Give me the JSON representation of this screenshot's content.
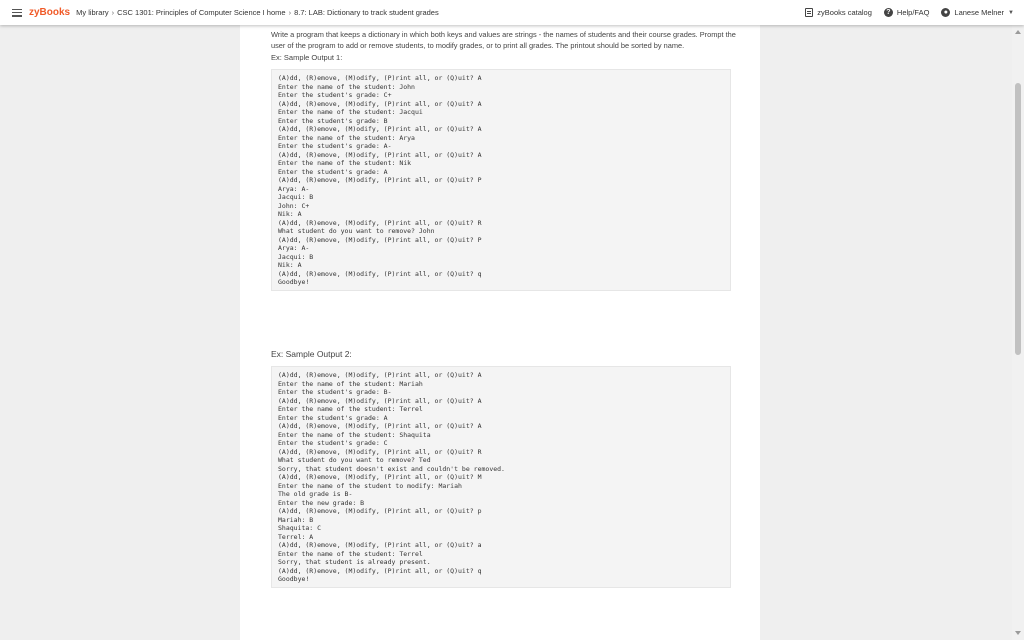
{
  "header": {
    "logo": "zyBooks",
    "breadcrumbs": [
      "My library",
      "CSC 1301: Principles of Computer Science I home",
      "8.7: LAB: Dictionary to track student grades"
    ],
    "catalog_label": "zyBooks catalog",
    "help_label": "Help/FAQ",
    "user_name": "Lanese Melner"
  },
  "content": {
    "intro": "Write a program that keeps a dictionary in which both keys and values are strings - the names of students and their course grades. Prompt the user of the program to add or remove students, to modify grades, or to print all grades. The printout should be sorted by name.",
    "sample1_label": "Ex: Sample Output 1:",
    "sample1_lines": [
      "(A)dd, (R)emove, (M)odify, (P)rint all, or (Q)uit? A",
      "Enter the name of the student: John",
      "Enter the student's grade: C+",
      "(A)dd, (R)emove, (M)odify, (P)rint all, or (Q)uit? A",
      "Enter the name of the student: Jacqui",
      "Enter the student's grade: B",
      "(A)dd, (R)emove, (M)odify, (P)rint all, or (Q)uit? A",
      "Enter the name of the student: Arya",
      "Enter the student's grade: A-",
      "(A)dd, (R)emove, (M)odify, (P)rint all, or (Q)uit? A",
      "Enter the name of the student: Nik",
      "Enter the student's grade: A",
      "(A)dd, (R)emove, (M)odify, (P)rint all, or (Q)uit? P",
      "Arya: A-",
      "Jacqui: B",
      "John: C+",
      "Nik: A",
      "(A)dd, (R)emove, (M)odify, (P)rint all, or (Q)uit? R",
      "What student do you want to remove? John",
      "(A)dd, (R)emove, (M)odify, (P)rint all, or (Q)uit? P",
      "Arya: A-",
      "Jacqui: B",
      "Nik: A",
      "(A)dd, (R)emove, (M)odify, (P)rint all, or (Q)uit? q",
      "Goodbye!"
    ],
    "sample2_label": "Ex: Sample Output 2:",
    "sample2_lines": [
      "(A)dd, (R)emove, (M)odify, (P)rint all, or (Q)uit? A",
      "Enter the name of the student: Mariah",
      "Enter the student's grade: B-",
      "(A)dd, (R)emove, (M)odify, (P)rint all, or (Q)uit? A",
      "Enter the name of the student: Terrel",
      "Enter the student's grade: A",
      "(A)dd, (R)emove, (M)odify, (P)rint all, or (Q)uit? A",
      "Enter the name of the student: Shaquita",
      "Enter the student's grade: C",
      "(A)dd, (R)emove, (M)odify, (P)rint all, or (Q)uit? R",
      "What student do you want to remove? Ted",
      "Sorry, that student doesn't exist and couldn't be removed.",
      "(A)dd, (R)emove, (M)odify, (P)rint all, or (Q)uit? M",
      "Enter the name of the student to modify: Mariah",
      "The old grade is B-",
      "Enter the new grade: B",
      "(A)dd, (R)emove, (M)odify, (P)rint all, or (Q)uit? p",
      "Mariah: B",
      "Shaquita: C",
      "Terrel: A",
      "(A)dd, (R)emove, (M)odify, (P)rint all, or (Q)uit? a",
      "Enter the name of the student: Terrel",
      "Sorry, that student is already present.",
      "(A)dd, (R)emove, (M)odify, (P)rint all, or (Q)uit? q",
      "Goodbye!"
    ]
  },
  "colors": {
    "brand": "#f05a28",
    "background": "#efefef",
    "code_background": "#f4f4f4"
  },
  "icons": [
    "hamburger-menu-icon",
    "catalog-book-icon",
    "help-question-icon",
    "user-account-icon",
    "chevron-down-icon"
  ]
}
